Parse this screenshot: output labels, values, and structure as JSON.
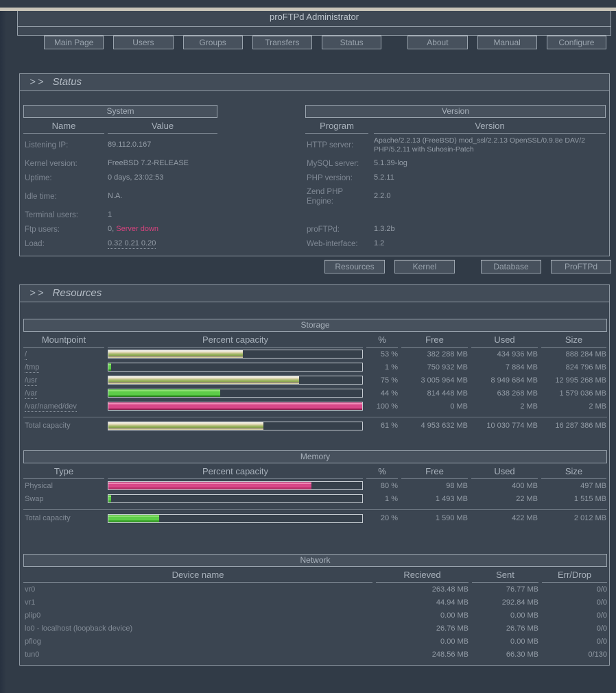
{
  "page": {
    "title": "proFTPd Administrator"
  },
  "nav": {
    "items": [
      "Main Page",
      "Users",
      "Groups",
      "Transfers",
      "Status",
      "About",
      "Manual",
      "Configure"
    ]
  },
  "status": {
    "prefix": ">>",
    "title": "Status",
    "system": {
      "title": "System",
      "col_name": "Name",
      "col_value": "Value",
      "rows": [
        {
          "name": "Listening IP:",
          "value": "89.112.0.167"
        },
        {
          "name": "Kernel version:",
          "value": "FreeBSD 7.2-RELEASE"
        },
        {
          "name": "Uptime:",
          "value": "0 days, 23:02:53"
        },
        {
          "name": "Idle time:",
          "value": "N.A."
        },
        {
          "name": "Terminal users:",
          "value": "1"
        },
        {
          "name": "Ftp users:",
          "value": "0,",
          "value_alert": "Server down"
        },
        {
          "name": "Load:",
          "value": "0.32 0.21 0.20"
        }
      ]
    },
    "version": {
      "title": "Version",
      "col_program": "Program",
      "col_version": "Version",
      "rows": [
        {
          "name": "HTTP server:",
          "value": "Apache/2.2.13 (FreeBSD) mod_ssl/2.2.13 OpenSSL/0.9.8e DAV/2 PHP/5.2.11 with Suhosin-Patch"
        },
        {
          "name": "MySQL server:",
          "value": "5.1.39-log"
        },
        {
          "name": "PHP version:",
          "value": "5.2.11"
        },
        {
          "name": "Zend PHP Engine:",
          "value": "2.2.0"
        },
        {
          "name": "",
          "value": ""
        },
        {
          "name": "proFTPd:",
          "value": "1.3.2b"
        },
        {
          "name": "Web-interface:",
          "value": "1.2"
        }
      ]
    },
    "buttons": [
      "Resources",
      "Kernel",
      "Database",
      "ProFTPd"
    ]
  },
  "resources": {
    "prefix": ">>",
    "title": "Resources",
    "storage": {
      "title": "Storage",
      "headers": [
        "Mountpoint",
        "Percent capacity",
        "%",
        "Free",
        "Used",
        "Size"
      ],
      "rows": [
        {
          "name": "/",
          "pct": 53,
          "pct_label": "53 %",
          "free": "382 288 MB",
          "used": "434 936 MB",
          "size": "888 284 MB",
          "color": "yellow"
        },
        {
          "name": "/tmp",
          "pct": 1,
          "pct_label": "1 %",
          "free": "750 932 MB",
          "used": "7 884 MB",
          "size": "824 796 MB",
          "color": "green"
        },
        {
          "name": "/usr",
          "pct": 75,
          "pct_label": "75 %",
          "free": "3 005 964 MB",
          "used": "8 949 684 MB",
          "size": "12 995 268 MB",
          "color": "yellow"
        },
        {
          "name": "/var",
          "pct": 44,
          "pct_label": "44 %",
          "free": "814 448 MB",
          "used": "638 268 MB",
          "size": "1 579 036 MB",
          "color": "green"
        },
        {
          "name": "/var/named/dev",
          "pct": 100,
          "pct_label": "100 %",
          "free": "0 MB",
          "used": "2 MB",
          "size": "2 MB",
          "color": "pink"
        }
      ],
      "total": {
        "name": "Total capacity",
        "pct": 61,
        "pct_label": "61 %",
        "free": "4 953 632 MB",
        "used": "10 030 774 MB",
        "size": "16 287 386 MB",
        "color": "yellow"
      }
    },
    "memory": {
      "title": "Memory",
      "headers": [
        "Type",
        "Percent capacity",
        "%",
        "Free",
        "Used",
        "Size"
      ],
      "rows": [
        {
          "name": "Physical",
          "pct": 80,
          "pct_label": "80 %",
          "free": "98 MB",
          "used": "400 MB",
          "size": "497 MB",
          "color": "pink"
        },
        {
          "name": "Swap",
          "pct": 1,
          "pct_label": "1 %",
          "free": "1 493 MB",
          "used": "22 MB",
          "size": "1 515 MB",
          "color": "green"
        }
      ],
      "total": {
        "name": "Total capacity",
        "pct": 20,
        "pct_label": "20 %",
        "free": "1 590 MB",
        "used": "422 MB",
        "size": "2 012 MB",
        "color": "green"
      }
    },
    "network": {
      "title": "Network",
      "headers": [
        "Device name",
        "Recieved",
        "Sent",
        "Err/Drop"
      ],
      "rows": [
        {
          "name": "vr0",
          "received": "263.48 MB",
          "sent": "76.77 MB",
          "err": "0/0"
        },
        {
          "name": "vr1",
          "received": "44.94 MB",
          "sent": "292.84 MB",
          "err": "0/0"
        },
        {
          "name": "plip0",
          "received": "0.00 MB",
          "sent": "0.00 MB",
          "err": "0/0"
        },
        {
          "name": "lo0 - localhost (loopback device)",
          "received": "26.76 MB",
          "sent": "26.76 MB",
          "err": "0/0"
        },
        {
          "name": "pflog",
          "received": "0.00 MB",
          "sent": "0.00 MB",
          "err": "0/0"
        },
        {
          "name": "tun0",
          "received": "248.56 MB",
          "sent": "66.30 MB",
          "err": "0/130"
        }
      ]
    }
  },
  "colors": {
    "bar_green": "#5ecd49",
    "bar_yellow": "#d5cea3",
    "bar_pink": "#d94889",
    "alert_text": "#d6437e"
  }
}
